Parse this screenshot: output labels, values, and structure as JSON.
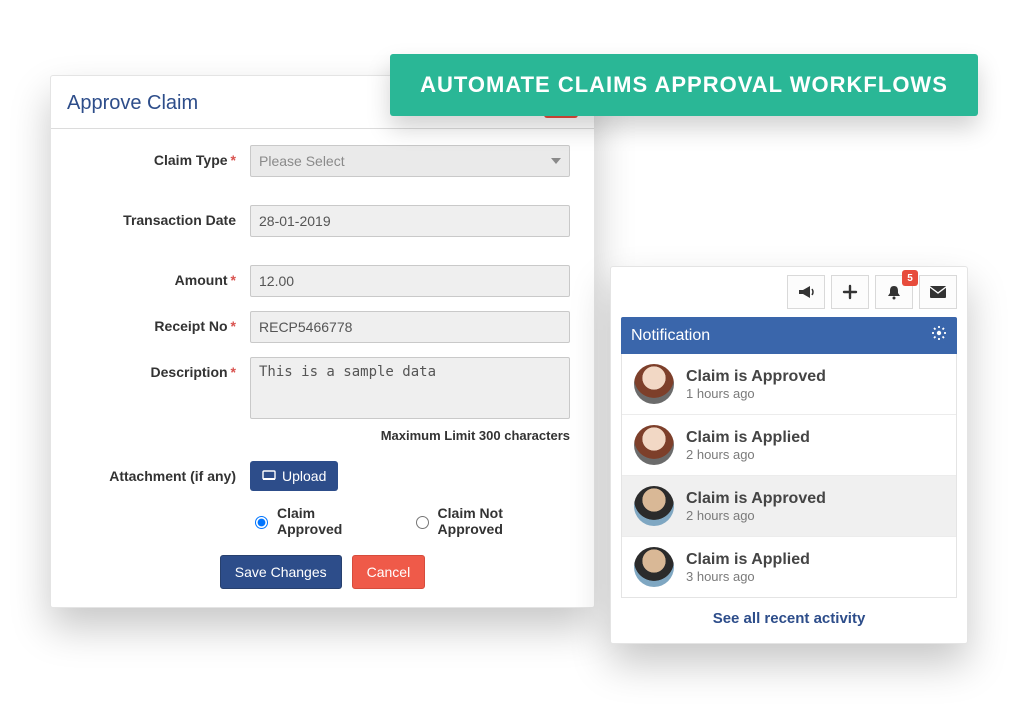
{
  "banner": {
    "text": "AUTOMATE CLAIMS APPROVAL WORKFLOWS"
  },
  "modal": {
    "title": "Approve Claim",
    "labels": {
      "claim_type": "Claim Type",
      "transaction_date": "Transaction Date",
      "amount": "Amount",
      "receipt_no": "Receipt No",
      "description": "Description",
      "attachment": "Attachment (if any)"
    },
    "claim_type": {
      "placeholder": "Please Select"
    },
    "transaction_date": {
      "value": "28-01-2019"
    },
    "amount": {
      "value": "12.00"
    },
    "receipt_no": {
      "value": "RECP5466778"
    },
    "description": {
      "value": "This is a sample data",
      "helper": "Maximum Limit 300 characters"
    },
    "upload_label": "Upload",
    "radios": {
      "approved": "Claim Approved",
      "not_approved": "Claim Not Approved",
      "selected": "approved"
    },
    "actions": {
      "save": "Save Changes",
      "cancel": "Cancel"
    }
  },
  "notifications": {
    "header": "Notification",
    "badge": "5",
    "items": [
      {
        "title": "Claim is Approved",
        "time": "1 hours ago",
        "avatar": "av1"
      },
      {
        "title": "Claim is Applied",
        "time": "2 hours ago",
        "avatar": "av1"
      },
      {
        "title": "Claim is Approved",
        "time": "2 hours ago",
        "avatar": "av2"
      },
      {
        "title": "Claim is Applied",
        "time": "3 hours ago",
        "avatar": "av2"
      }
    ],
    "footer": "See all recent activity"
  }
}
